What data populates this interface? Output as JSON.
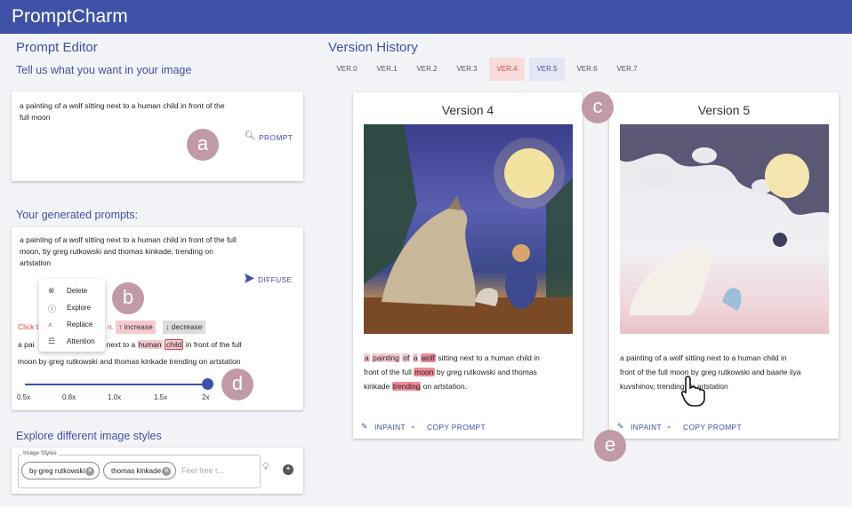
{
  "app": {
    "title": "PromptCharm"
  },
  "editor": {
    "heading": "Prompt Editor",
    "subheading": "Tell us what you want in your image",
    "input_text": "a painting of a wolf sitting next to a human child in front of the full moon",
    "prompt_button": "PROMPT"
  },
  "generated": {
    "heading": "Your generated prompts:",
    "text": "a painting of a wolf sitting next to a human child in front of the full moon, by greg rutkowski and thomas kinkade, trending on artstation",
    "diffuse_button": "DIFFUSE",
    "click_hint_start": "Click t",
    "click_hint_end": "n.",
    "increase_label": "↑ increase",
    "decrease_label": "↓ decrease",
    "edit_line1_a": "a pai",
    "edit_line1_b": "tting next to a",
    "edit_word_human": "human",
    "edit_word_child": "child",
    "edit_line1_c": "in front of the full",
    "edit_line2": "moon by greg rutkowski and thomas kinkade trending on artstation",
    "context_menu": [
      {
        "label": "Delete",
        "icon": "delete-circle-icon"
      },
      {
        "label": "Explore",
        "icon": "help-circle-icon"
      },
      {
        "label": "Replace",
        "icon": "find-replace-icon"
      },
      {
        "label": "Attention",
        "icon": "tune-icon"
      }
    ],
    "slider": {
      "labels": [
        "0.5x",
        "0.8x",
        "1.0x",
        "1.5x",
        "2x"
      ],
      "value_fraction": 1.0
    }
  },
  "styles": {
    "heading": "Explore different image styles",
    "field_label": "Image Styles",
    "chips": [
      "by greg rutkowski",
      "thomas kinkade"
    ],
    "placeholder": "Feel free t..."
  },
  "history": {
    "heading": "Version History",
    "tabs": [
      "VER.0",
      "VER.1",
      "VER.2",
      "VER.3",
      "VER.4",
      "VER.5",
      "VER.6",
      "VER.7"
    ],
    "selected_tabs": [
      "VER.4",
      "VER.5"
    ],
    "cards": [
      {
        "title": "Version 4",
        "words_line1": [
          "a",
          "painting",
          "of",
          "a",
          "wolf",
          "sitting",
          "next",
          "to",
          "a",
          "human",
          "child",
          "in"
        ],
        "text_line2": "front of the full",
        "word_moon": "moon",
        "text_line2b": "by greg rutkowski and thomas",
        "text_line3a": "kinkade",
        "word_trending": "trending",
        "text_line3b": "on artstation.",
        "inpaint": "INPAINT",
        "copy": "COPY PROMPT"
      },
      {
        "title": "Version 5",
        "text_line1": "a painting of a wolf sitting next to a human child in",
        "text_line2": "front of the full moon by greg rutkowski and baarle ilya",
        "text_line3": "kuvshinov, trending on artstation",
        "inpaint": "INPAINT",
        "copy": "COPY PROMPT"
      }
    ]
  },
  "annotations": [
    "a",
    "b",
    "c",
    "d",
    "e"
  ],
  "colors": {
    "brand": "#3f51a7",
    "highlight_red": "#f6c9cf",
    "highlight_green": "#c4e3bd",
    "badge": "#c09aa4"
  }
}
